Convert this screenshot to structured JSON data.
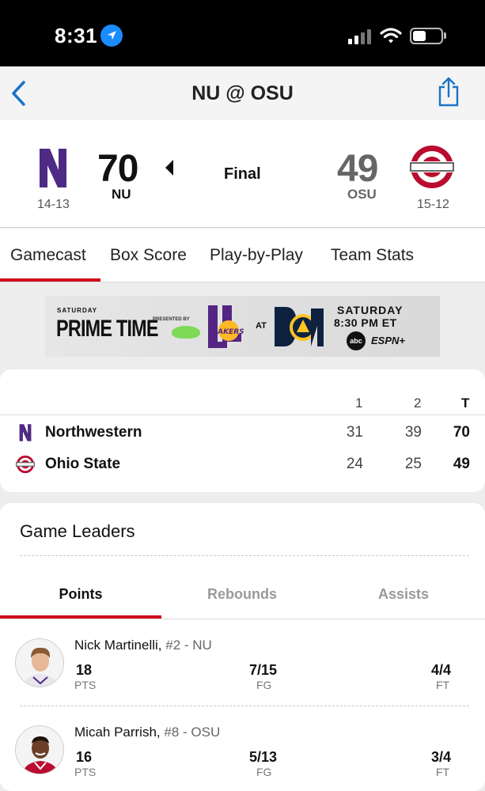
{
  "status_bar": {
    "time": "8:31"
  },
  "nav": {
    "title": "NU @ OSU"
  },
  "game": {
    "away": {
      "abbr": "NU",
      "score": "70",
      "record": "14-13"
    },
    "home": {
      "abbr": "OSU",
      "score": "49",
      "record": "15-12"
    },
    "status": "Final"
  },
  "tabs": [
    "Gamecast",
    "Box Score",
    "Play-by-Play",
    "Team Stats"
  ],
  "ad": {
    "line1": "SATURDAY",
    "brand": "PRIME TIME",
    "presented": "PRESENTED BY",
    "at": "AT",
    "when1": "SATURDAY",
    "when2": "8:30 PM ET",
    "net1": "abc",
    "net2": "ESPN+"
  },
  "linescore": {
    "headers": [
      "1",
      "2",
      "T"
    ],
    "rows": [
      {
        "team": "Northwestern",
        "periods": [
          "31",
          "39"
        ],
        "total": "70"
      },
      {
        "team": "Ohio State",
        "periods": [
          "24",
          "25"
        ],
        "total": "49"
      }
    ]
  },
  "leaders": {
    "title": "Game Leaders",
    "tabs": [
      "Points",
      "Rebounds",
      "Assists"
    ],
    "players": [
      {
        "name": "Nick Martinelli,",
        "meta": "#2 - NU",
        "stats": [
          {
            "value": "18",
            "label": "PTS"
          },
          {
            "value": "7/15",
            "label": "FG"
          },
          {
            "value": "4/4",
            "label": "FT"
          }
        ]
      },
      {
        "name": "Micah Parrish,",
        "meta": "#8 - OSU",
        "stats": [
          {
            "value": "16",
            "label": "PTS"
          },
          {
            "value": "5/13",
            "label": "FG"
          },
          {
            "value": "3/4",
            "label": "FT"
          }
        ]
      }
    ]
  },
  "colors": {
    "accent": "#d0021b",
    "nu_purple": "#4e2a84",
    "osu_scarlet": "#ba0c2f",
    "link_blue": "#1a73c8"
  }
}
